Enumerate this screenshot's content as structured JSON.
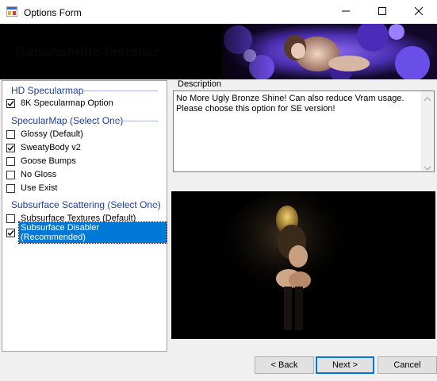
{
  "window": {
    "title": "Options Form",
    "header_text": "Bananaholic Installer",
    "controls": {
      "minimize_icon": "minimize-icon",
      "maximize_icon": "maximize-icon",
      "close_icon": "close-icon"
    }
  },
  "sections": [
    {
      "title": "HD Specularmap",
      "options": [
        {
          "label": "8K Specularmap Option",
          "checked": true
        }
      ]
    },
    {
      "title": "SpecularMap (Select One)",
      "options": [
        {
          "label": "Glossy (Default)",
          "checked": false
        },
        {
          "label": "SweatyBody v2",
          "checked": true
        },
        {
          "label": "Goose Bumps",
          "checked": false
        },
        {
          "label": "No Gloss",
          "checked": false
        },
        {
          "label": "Use Exist",
          "checked": false
        }
      ]
    },
    {
      "title": "Subsurface Scattering (Select One)",
      "options": [
        {
          "label": "Subsurface Textures (Default)",
          "checked": false
        },
        {
          "label": "Subsurface Disabler (Recommended)",
          "checked": true,
          "selected": true
        }
      ]
    }
  ],
  "description": {
    "label": "Description",
    "text": "No More Ugly Bronze Shine! Can also reduce Vram usage. Please choose this option for SE version!"
  },
  "buttons": {
    "back": "< Back",
    "next": "Next >",
    "cancel": "Cancel"
  },
  "colors": {
    "accent": "#0078d7",
    "section_title": "#1f3da0",
    "window_bg": "#f0f0f0"
  }
}
